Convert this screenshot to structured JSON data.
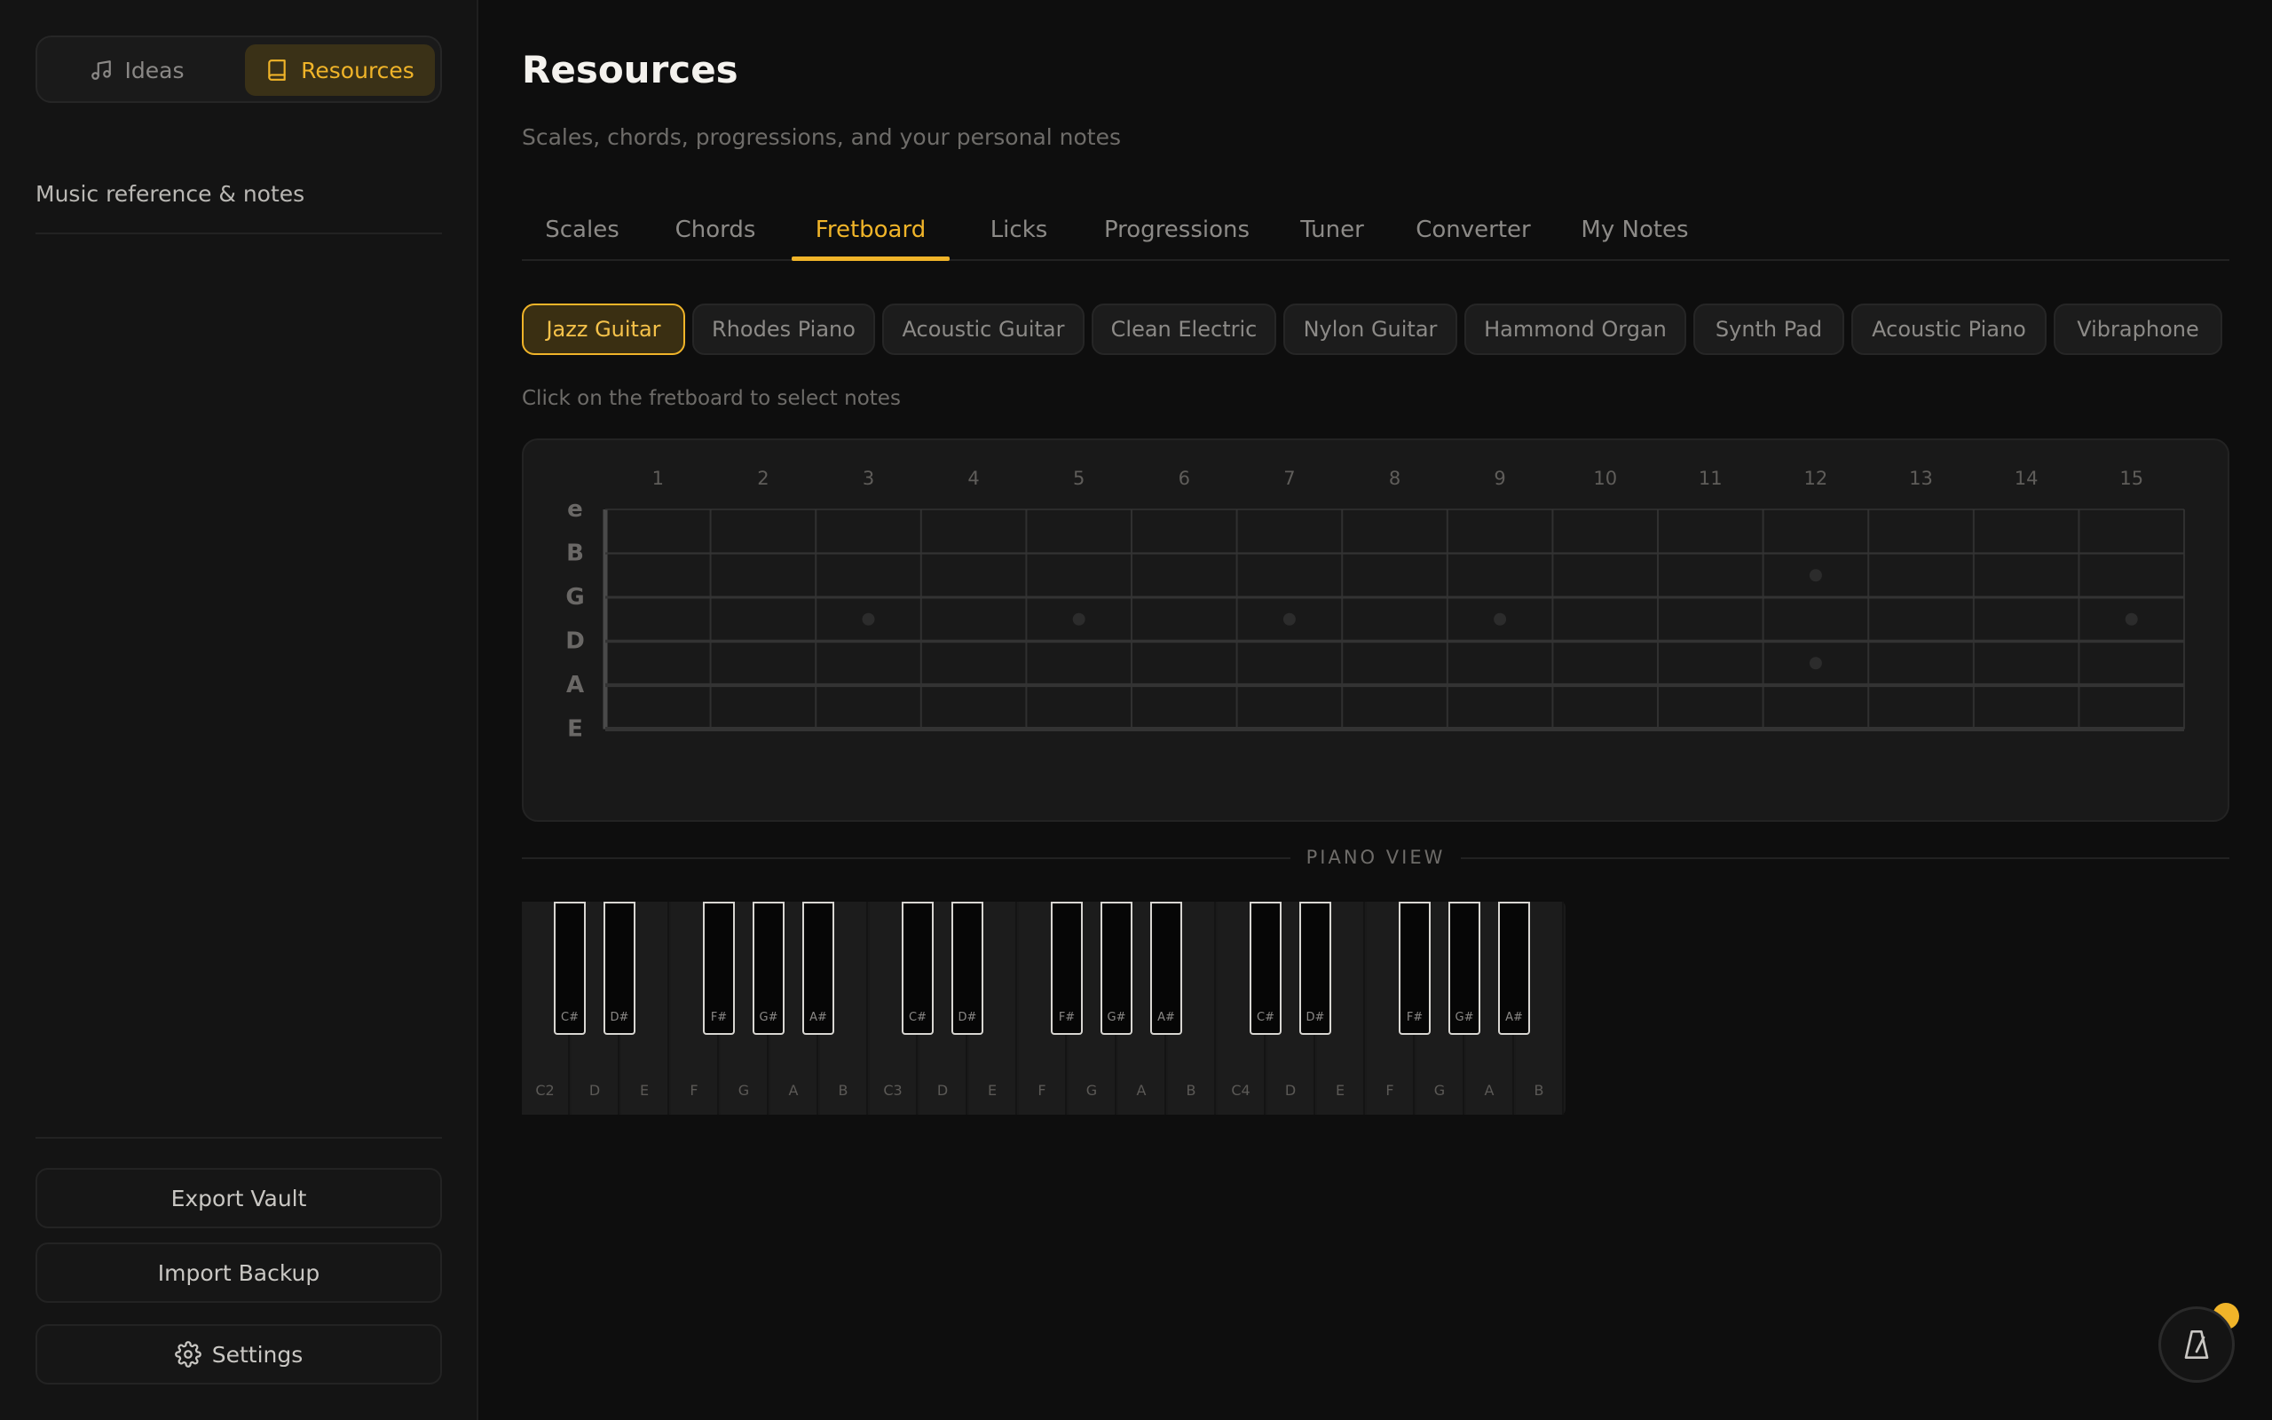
{
  "switcher": {
    "ideas_label": "Ideas",
    "resources_label": "Resources"
  },
  "sidebar": {
    "caption": "Music reference & notes",
    "export_label": "Export Vault",
    "import_label": "Import Backup",
    "settings_label": "Settings"
  },
  "header": {
    "title": "Resources",
    "subtitle": "Scales, chords, progressions, and your personal notes"
  },
  "tabs": [
    {
      "label": "Scales"
    },
    {
      "label": "Chords"
    },
    {
      "label": "Fretboard",
      "active": true
    },
    {
      "label": "Licks"
    },
    {
      "label": "Progressions"
    },
    {
      "label": "Tuner"
    },
    {
      "label": "Converter"
    },
    {
      "label": "My Notes"
    }
  ],
  "instruments": [
    {
      "label": "Jazz Guitar",
      "active": true
    },
    {
      "label": "Rhodes Piano"
    },
    {
      "label": "Acoustic Guitar"
    },
    {
      "label": "Clean Electric"
    },
    {
      "label": "Nylon Guitar"
    },
    {
      "label": "Hammond Organ"
    },
    {
      "label": "Synth Pad"
    },
    {
      "label": "Acoustic Piano"
    },
    {
      "label": "Vibraphone"
    }
  ],
  "fretboard": {
    "hint": "Click on the fretboard to select notes",
    "fret_numbers": [
      "1",
      "2",
      "3",
      "4",
      "5",
      "6",
      "7",
      "8",
      "9",
      "10",
      "11",
      "12",
      "13",
      "14",
      "15"
    ],
    "strings": [
      "e",
      "B",
      "G",
      "D",
      "A",
      "E"
    ],
    "single_dot_frets": [
      3,
      5,
      7,
      9,
      15
    ],
    "double_dot_frets": [
      12
    ]
  },
  "piano": {
    "label": "PIANO VIEW",
    "white_keys": [
      "C2",
      "D",
      "E",
      "F",
      "G",
      "A",
      "B",
      "C3",
      "D",
      "E",
      "F",
      "G",
      "A",
      "B",
      "C4",
      "D",
      "E",
      "F",
      "G",
      "A",
      "B"
    ],
    "black_keys": [
      "C#",
      "D#",
      "F#",
      "G#",
      "A#",
      "C#",
      "D#",
      "F#",
      "G#",
      "A#",
      "C#",
      "D#",
      "F#",
      "G#",
      "A#"
    ]
  },
  "colors": {
    "accent": "#f0b429",
    "background": "#0e0e0e",
    "sidebar": "#141414"
  },
  "icons": {
    "ideas": "music-note-icon",
    "resources": "book-icon",
    "settings": "gear-icon",
    "fab": "metronome-icon"
  }
}
